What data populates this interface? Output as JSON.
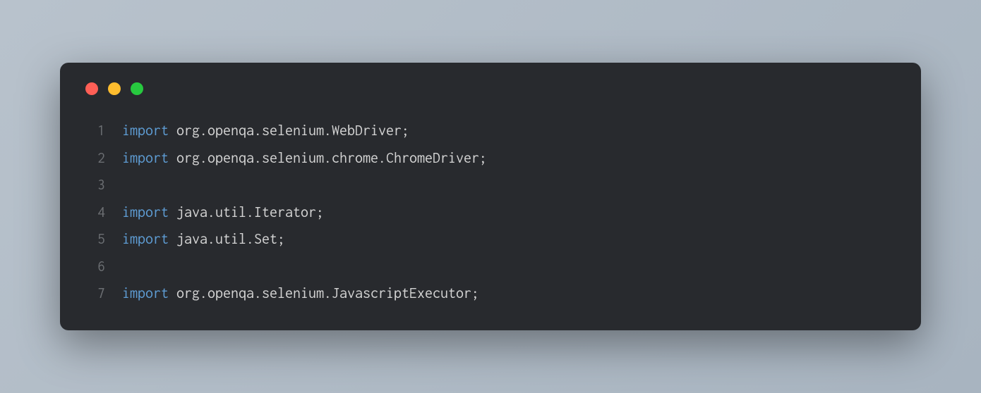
{
  "colors": {
    "background": "#282a2e",
    "red": "#ff5f56",
    "yellow": "#ffbd2e",
    "green": "#27c93f",
    "keyword": "#5e9cd3",
    "text": "#d4d4d4",
    "lineNumber": "#6b6e72"
  },
  "code": {
    "lines": [
      {
        "number": "1",
        "tokens": [
          {
            "type": "keyword",
            "text": "import"
          },
          {
            "type": "text",
            "text": " org.openqa.selenium.WebDriver;"
          }
        ]
      },
      {
        "number": "2",
        "tokens": [
          {
            "type": "keyword",
            "text": "import"
          },
          {
            "type": "text",
            "text": " org.openqa.selenium.chrome.ChromeDriver;"
          }
        ]
      },
      {
        "number": "3",
        "tokens": []
      },
      {
        "number": "4",
        "tokens": [
          {
            "type": "keyword",
            "text": "import"
          },
          {
            "type": "text",
            "text": " java.util.Iterator;"
          }
        ]
      },
      {
        "number": "5",
        "tokens": [
          {
            "type": "keyword",
            "text": "import"
          },
          {
            "type": "text",
            "text": " java.util.Set;"
          }
        ]
      },
      {
        "number": "6",
        "tokens": []
      },
      {
        "number": "7",
        "tokens": [
          {
            "type": "keyword",
            "text": "import"
          },
          {
            "type": "text",
            "text": " org.openqa.selenium.JavascriptExecutor;"
          }
        ]
      }
    ]
  }
}
